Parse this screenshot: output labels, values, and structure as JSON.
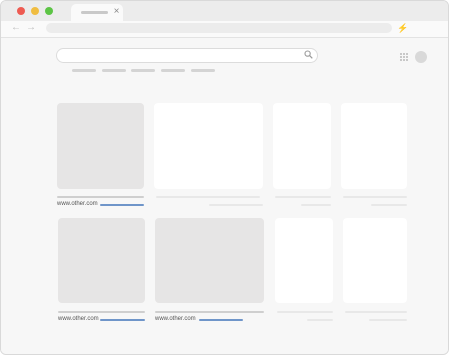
{
  "browser": {
    "tab_close_glyph": "×",
    "nav_back_glyph": "←",
    "nav_forward_glyph": "→",
    "extension_glyph": "⚡"
  },
  "search": {
    "icon": "search-icon"
  },
  "results": {
    "row1": {
      "source_1": "www.other.com"
    },
    "row2": {
      "source_1": "www.other.com",
      "source_2": "www.other.com"
    }
  },
  "colors": {
    "close_red": "#ee5b52",
    "minimize_yellow": "#f0bd41",
    "zoom_green": "#5cc445",
    "link_blue": "#6f95c9"
  }
}
